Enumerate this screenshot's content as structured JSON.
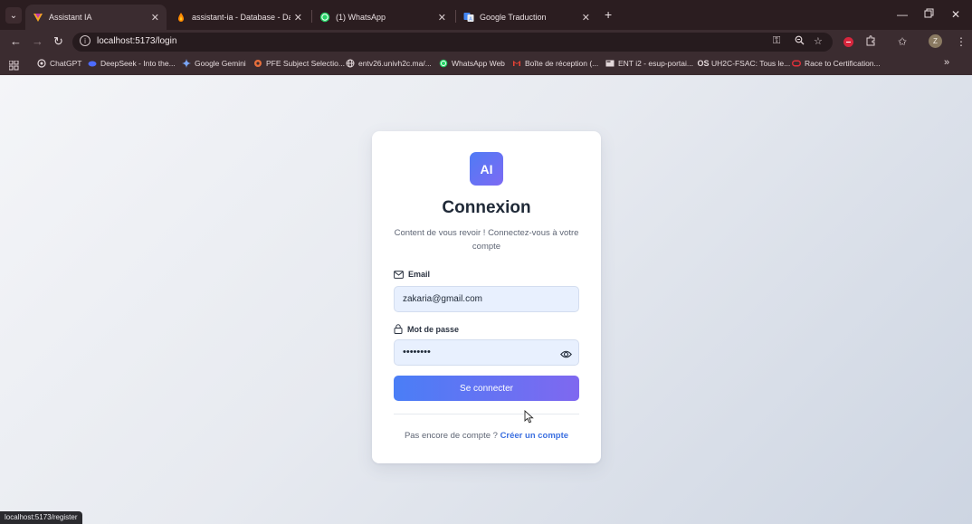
{
  "browser": {
    "tabs": [
      {
        "title": "Assistant IA",
        "active": true,
        "icon": "assistant-favicon"
      },
      {
        "title": "assistant-ia - Database - Data",
        "active": false,
        "icon": "firebase-favicon"
      },
      {
        "title": "(1) WhatsApp",
        "active": false,
        "icon": "whatsapp-favicon"
      },
      {
        "title": "Google Traduction",
        "active": false,
        "icon": "translate-favicon"
      }
    ],
    "url": "localhost:5173/login",
    "bookmarks": [
      {
        "label": "ChatGPT",
        "icon": "chatgpt-icon"
      },
      {
        "label": "DeepSeek - Into the...",
        "icon": "deepseek-icon"
      },
      {
        "label": "Google Gemini",
        "icon": "gemini-icon"
      },
      {
        "label": "PFE Subject Selectio...",
        "icon": "pfe-icon"
      },
      {
        "label": "entv26.univh2c.ma/...",
        "icon": "globe-icon"
      },
      {
        "label": "WhatsApp Web",
        "icon": "whatsapp-icon"
      },
      {
        "label": "Boîte de réception (...",
        "icon": "gmail-icon"
      },
      {
        "label": "ENT i2 - esup-portai...",
        "icon": "ent-icon"
      },
      {
        "label": "UH2C-FSAC: Tous le...",
        "icon": "uh2c-icon"
      },
      {
        "label": "Race to Certification...",
        "icon": "oracle-icon"
      }
    ],
    "profile_initial": "Z",
    "status_url": "localhost:5173/register"
  },
  "login": {
    "logo_text": "AI",
    "title": "Connexion",
    "subtitle": "Content de vous revoir ! Connectez-vous à votre compte",
    "email_label": "Email",
    "email_value": "zakaria@gmail.com",
    "password_label": "Mot de passe",
    "password_value": "••••••••",
    "submit_label": "Se connecter",
    "footer_text": "Pas encore de compte ?",
    "register_link": "Créer un compte"
  },
  "colors": {
    "accent_start": "#4a7ef6",
    "accent_end": "#7f68f0",
    "link": "#3b6fe0",
    "field_bg": "#e8f0fe"
  }
}
